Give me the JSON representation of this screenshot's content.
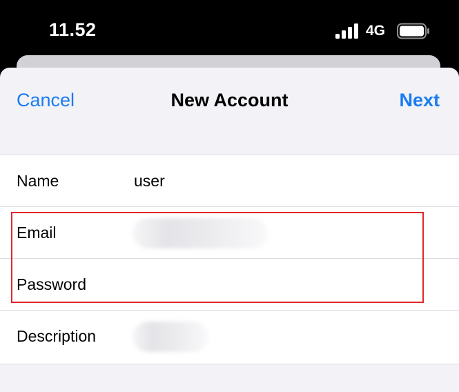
{
  "status_bar": {
    "time": "11.52",
    "network": "4G",
    "signal_icon": "cellular-signal-icon",
    "battery_icon": "battery-icon"
  },
  "nav": {
    "cancel_label": "Cancel",
    "title": "New Account",
    "next_label": "Next"
  },
  "form": {
    "name": {
      "label": "Name",
      "value": "user"
    },
    "email": {
      "label": "Email",
      "value_redacted": true
    },
    "password": {
      "label": "Password",
      "value": ""
    },
    "description": {
      "label": "Description",
      "value_redacted": true
    }
  },
  "colors": {
    "accent": "#1a7cf0",
    "sheet_background": "#f2f2f7",
    "highlight": "#e0262a"
  }
}
